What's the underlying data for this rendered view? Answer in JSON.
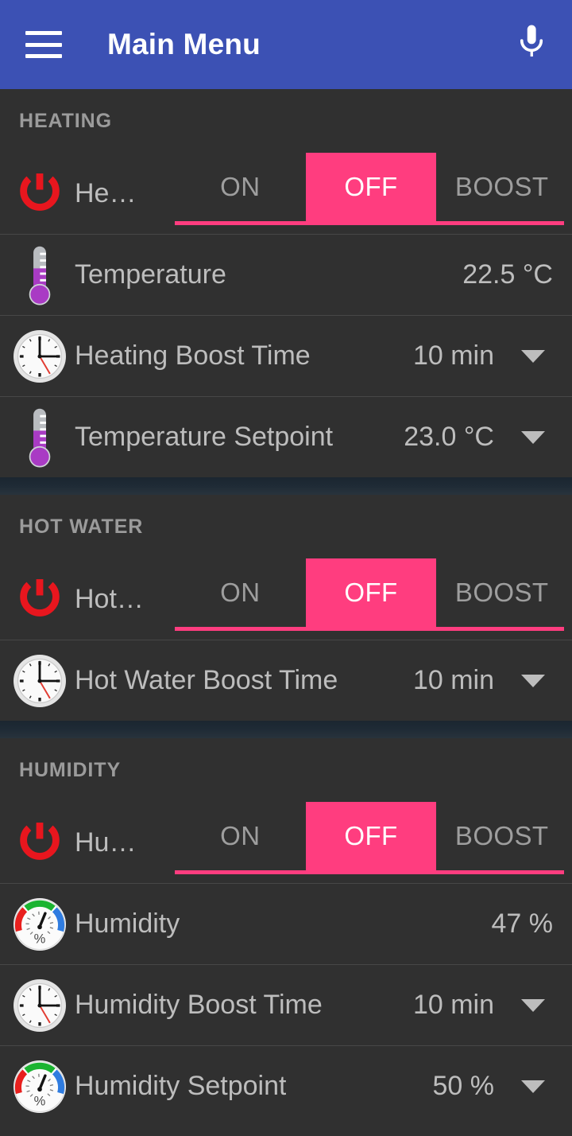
{
  "appbar": {
    "title": "Main Menu",
    "menu_icon": "hamburger-icon",
    "mic_icon": "microphone-icon",
    "background_color": "#3c51b4"
  },
  "theme": {
    "page_background": "#303030",
    "accent_pink": "#ff3d7f",
    "text_primary": "#bdbdbd",
    "text_muted": "#9e9e9e",
    "power_red": "#e8161e",
    "thermo_purple": "#a93bc4",
    "divider": "#474747",
    "section_band": "#1e2a35"
  },
  "sections": [
    {
      "header": "HEATING",
      "rows": [
        {
          "type": "segmented",
          "icon": "power-icon",
          "label": "He…",
          "options": [
            "ON",
            "OFF",
            "BOOST"
          ],
          "selected": "OFF"
        },
        {
          "type": "value",
          "icon": "thermometer-icon",
          "label": "Temperature",
          "value": "22.5 °C",
          "has_caret": false
        },
        {
          "type": "dropdown",
          "icon": "clock-icon",
          "label": "Heating Boost Time",
          "value": "10 min",
          "has_caret": true
        },
        {
          "type": "dropdown",
          "icon": "thermometer-icon",
          "label": "Temperature Setpoint",
          "value": "23.0 °C",
          "has_caret": true
        }
      ]
    },
    {
      "header": "HOT WATER",
      "rows": [
        {
          "type": "segmented",
          "icon": "power-icon",
          "label": "Hot…",
          "options": [
            "ON",
            "OFF",
            "BOOST"
          ],
          "selected": "OFF"
        },
        {
          "type": "dropdown",
          "icon": "clock-icon",
          "label": "Hot Water Boost Time",
          "value": "10 min",
          "has_caret": true
        }
      ]
    },
    {
      "header": "HUMIDITY",
      "rows": [
        {
          "type": "segmented",
          "icon": "power-icon",
          "label": "Hu…",
          "options": [
            "ON",
            "OFF",
            "BOOST"
          ],
          "selected": "OFF"
        },
        {
          "type": "value",
          "icon": "gauge-icon",
          "label": "Humidity",
          "value": "47 %",
          "has_caret": false
        },
        {
          "type": "dropdown",
          "icon": "clock-icon",
          "label": "Humidity Boost Time",
          "value": "10 min",
          "has_caret": true
        },
        {
          "type": "dropdown",
          "icon": "gauge-icon",
          "label": "Humidity Setpoint",
          "value": "50 %",
          "has_caret": true
        }
      ]
    }
  ]
}
